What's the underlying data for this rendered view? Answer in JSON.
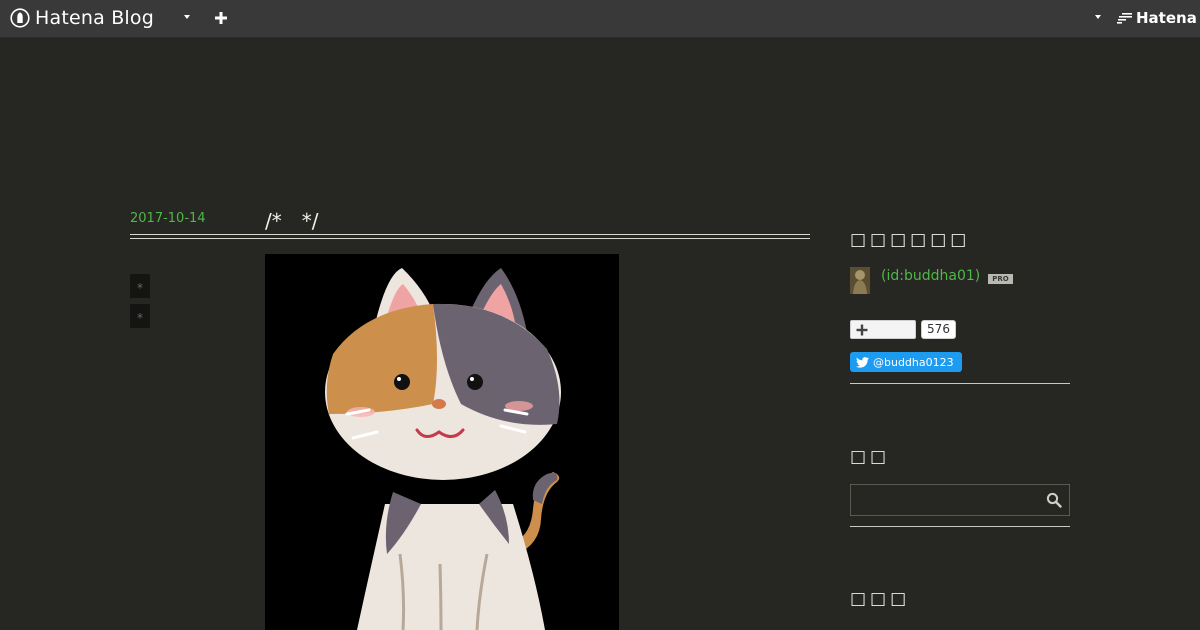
{
  "topbar": {
    "brand": "Hatena Blog",
    "hatena": "Hatena"
  },
  "entry": {
    "date": "2017-10-14",
    "title": "/*　*/",
    "side_markers": [
      "*",
      "*"
    ]
  },
  "sidebar": {
    "profile_heading": "□□□□□□",
    "user_id": "(id:buddha01)",
    "pro_badge": "PRO",
    "subscribe_count": "576",
    "twitter_handle": "@buddha0123",
    "search_heading": "□□",
    "search_placeholder": "",
    "third_heading": "□□□"
  },
  "colors": {
    "background": "#262622",
    "topbar": "#393939",
    "accent_green": "#4fb848",
    "twitter_blue": "#1d9bf0"
  },
  "icons": {
    "brand": "hatena-blog-logo-icon",
    "menu": "caret-down-icon",
    "add": "plus-icon",
    "subscribe": "plus-icon",
    "twitter": "twitter-bird-icon",
    "search": "search-icon"
  }
}
